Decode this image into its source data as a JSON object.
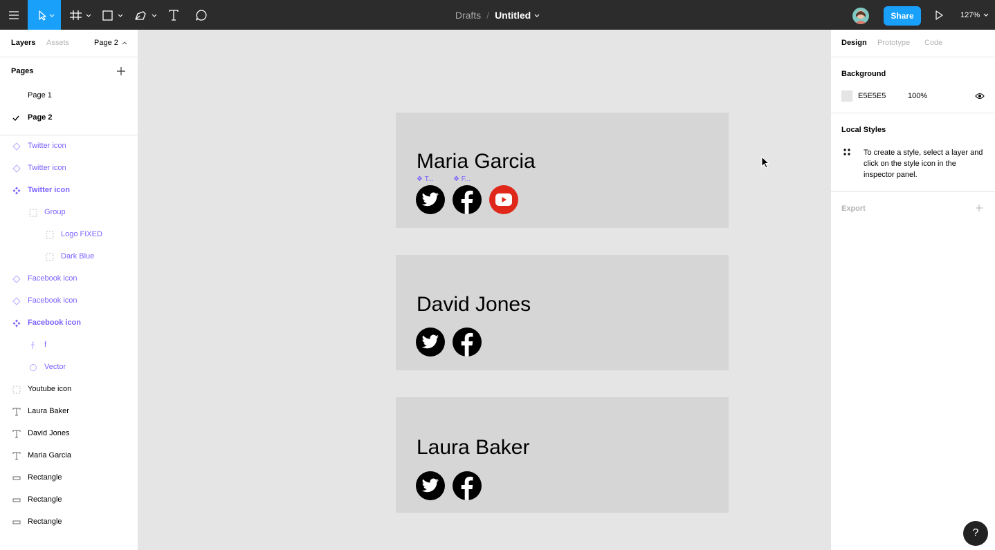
{
  "toolbar": {
    "breadcrumb_parent": "Drafts",
    "breadcrumb_sep": "/",
    "file_title": "Untitled",
    "share_label": "Share",
    "zoom": "127%",
    "accent": "#18a0fb"
  },
  "left_panel": {
    "tabs": [
      {
        "label": "Layers",
        "active": true
      },
      {
        "label": "Assets",
        "active": false
      }
    ],
    "page_switcher": "Page 2",
    "pages_title": "Pages",
    "pages": [
      {
        "label": "Page 1",
        "selected": false
      },
      {
        "label": "Page 2",
        "selected": true
      }
    ],
    "layers": [
      {
        "label": "Twitter icon",
        "icon": "component-variant-icon"
      },
      {
        "label": "Twitter icon",
        "icon": "component-variant-icon"
      },
      {
        "label": "Twitter icon",
        "icon": "component-icon"
      },
      {
        "label": "Group",
        "icon": "group-icon"
      },
      {
        "label": "Logo FIXED",
        "icon": "group-icon"
      },
      {
        "label": "Dark Blue",
        "icon": "group-icon"
      },
      {
        "label": "Facebook icon",
        "icon": "component-variant-icon"
      },
      {
        "label": "Facebook icon",
        "icon": "component-variant-icon"
      },
      {
        "label": "Facebook icon",
        "icon": "component-icon"
      },
      {
        "label": "f",
        "icon": "path-icon"
      },
      {
        "label": "Vector",
        "icon": "ellipse-icon"
      },
      {
        "label": "Youtube icon",
        "icon": "group-icon"
      },
      {
        "label": "Laura Baker",
        "icon": "text-icon"
      },
      {
        "label": "David Jones",
        "icon": "text-icon"
      },
      {
        "label": "Maria Garcia",
        "icon": "text-icon"
      },
      {
        "label": "Rectangle",
        "icon": "rectangle-icon"
      },
      {
        "label": "Rectangle",
        "icon": "rectangle-icon"
      },
      {
        "label": "Rectangle",
        "icon": "rectangle-icon"
      }
    ]
  },
  "canvas": {
    "cards": [
      {
        "name": "Maria Garcia",
        "icons": [
          "twitter-icon",
          "facebook-icon",
          "youtube-icon"
        ]
      },
      {
        "name": "David Jones",
        "icons": [
          "twitter-icon",
          "facebook-icon"
        ]
      },
      {
        "name": "Laura Baker",
        "icons": [
          "twitter-icon",
          "facebook-icon"
        ]
      }
    ],
    "selection_tags": [
      "T...",
      "F..."
    ]
  },
  "right_panel": {
    "tabs": [
      {
        "label": "Design",
        "active": true
      },
      {
        "label": "Prototype",
        "active": false
      },
      {
        "label": "Code",
        "active": false
      }
    ],
    "background_title": "Background",
    "background_hex": "E5E5E5",
    "background_opacity": "100%",
    "local_styles_title": "Local Styles",
    "local_styles_hint": "To create a style, select a layer and click on the style icon in the inspector panel.",
    "export_title": "Export"
  },
  "help_label": "?"
}
